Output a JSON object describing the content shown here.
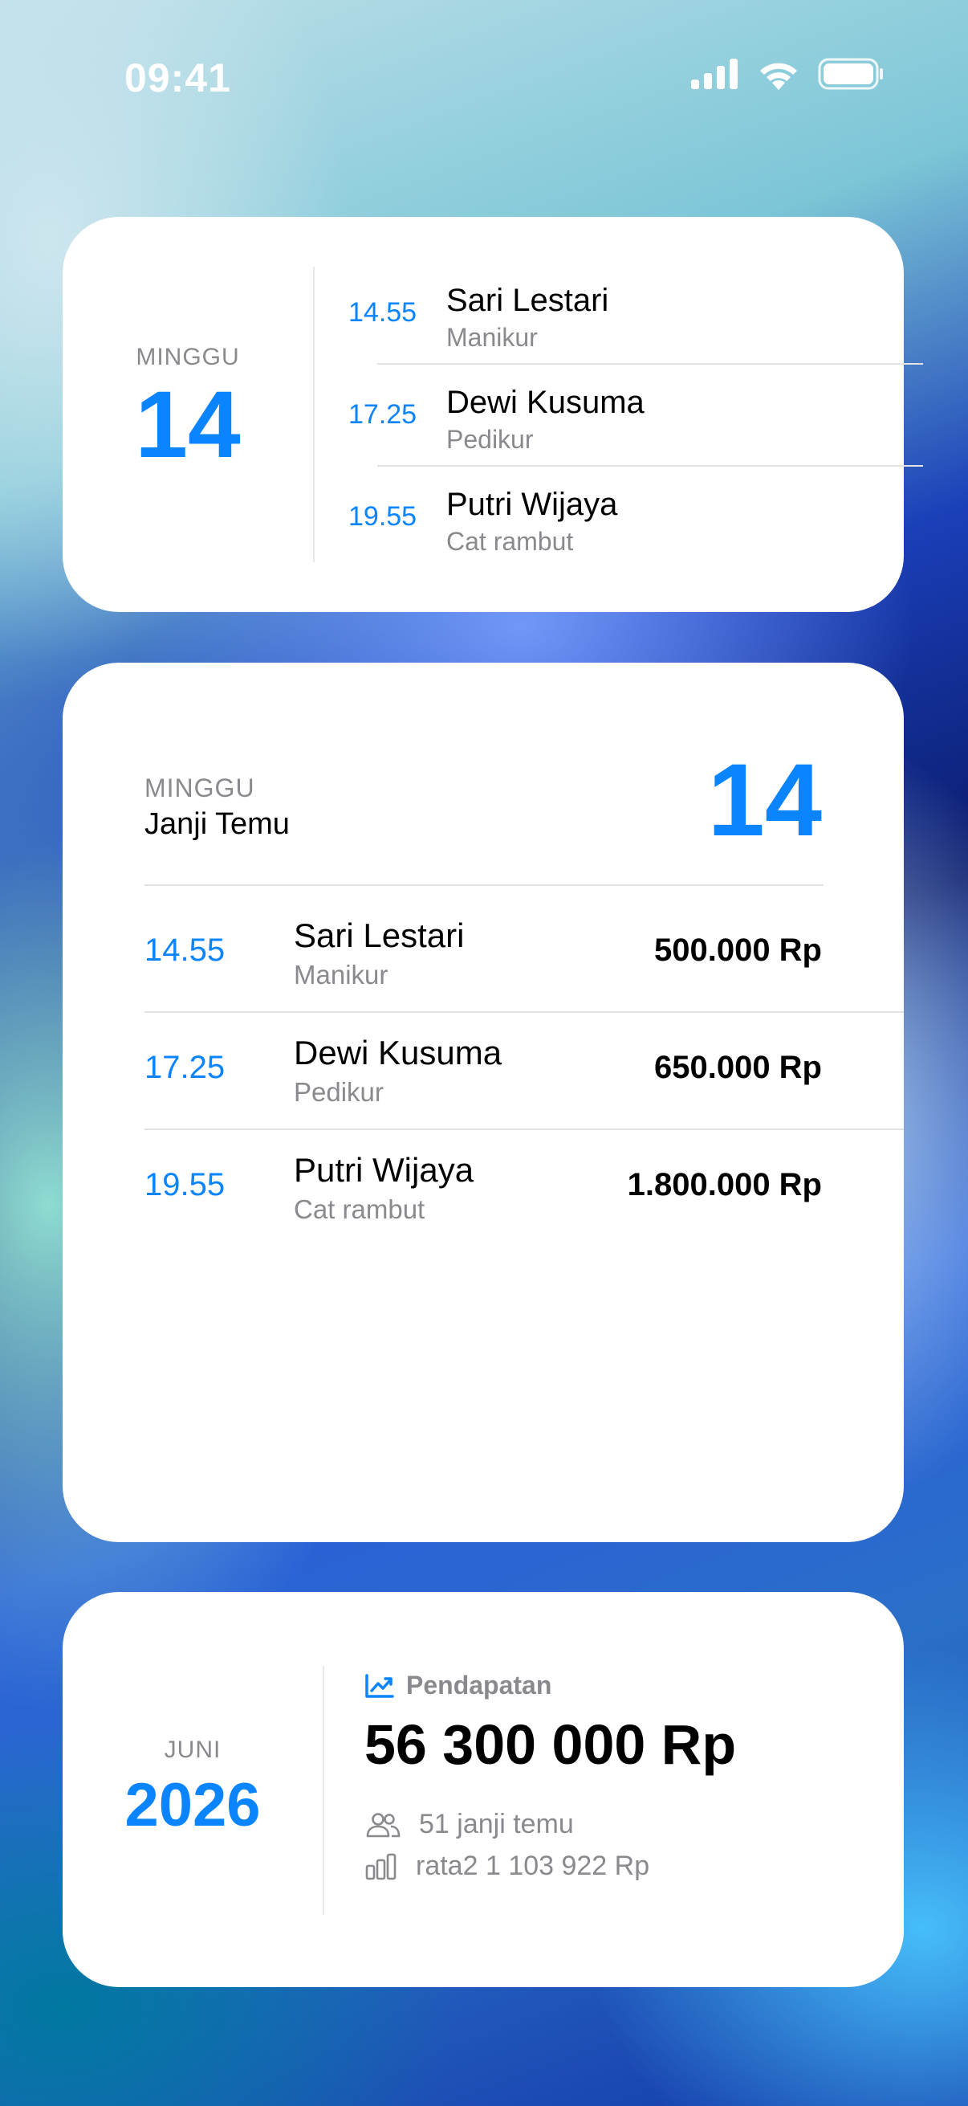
{
  "status_bar": {
    "time": "09:41",
    "icons": [
      "cellular-signal-icon",
      "wifi-icon",
      "battery-icon"
    ]
  },
  "colors": {
    "accent": "#0a84ff",
    "muted": "#8a8a8e",
    "card_bg": "#ffffff"
  },
  "widget_small": {
    "day_name": "MINGGU",
    "day_number": "14",
    "appointments": [
      {
        "time": "14.55",
        "name": "Sari Lestari",
        "service": "Manikur"
      },
      {
        "time": "17.25",
        "name": "Dewi Kusuma",
        "service": "Pedikur"
      },
      {
        "time": "19.55",
        "name": "Putri Wijaya",
        "service": "Cat rambut"
      }
    ]
  },
  "widget_large": {
    "day_name": "MINGGU",
    "title": "Janji Temu",
    "day_number": "14",
    "appointments": [
      {
        "time": "14.55",
        "name": "Sari Lestari",
        "service": "Manikur",
        "price": "500.000 Rp"
      },
      {
        "time": "17.25",
        "name": "Dewi Kusuma",
        "service": "Pedikur",
        "price": "650.000 Rp"
      },
      {
        "time": "19.55",
        "name": "Putri Wijaya",
        "service": "Cat rambut",
        "price": "1.800.000 Rp"
      }
    ]
  },
  "widget_revenue": {
    "month": "JUNI",
    "year": "2026",
    "label": "Pendapatan",
    "amount": "56 300 000 Rp",
    "appointments_count": "51 janji temu",
    "average": "rata2 1 103 922 Rp"
  }
}
